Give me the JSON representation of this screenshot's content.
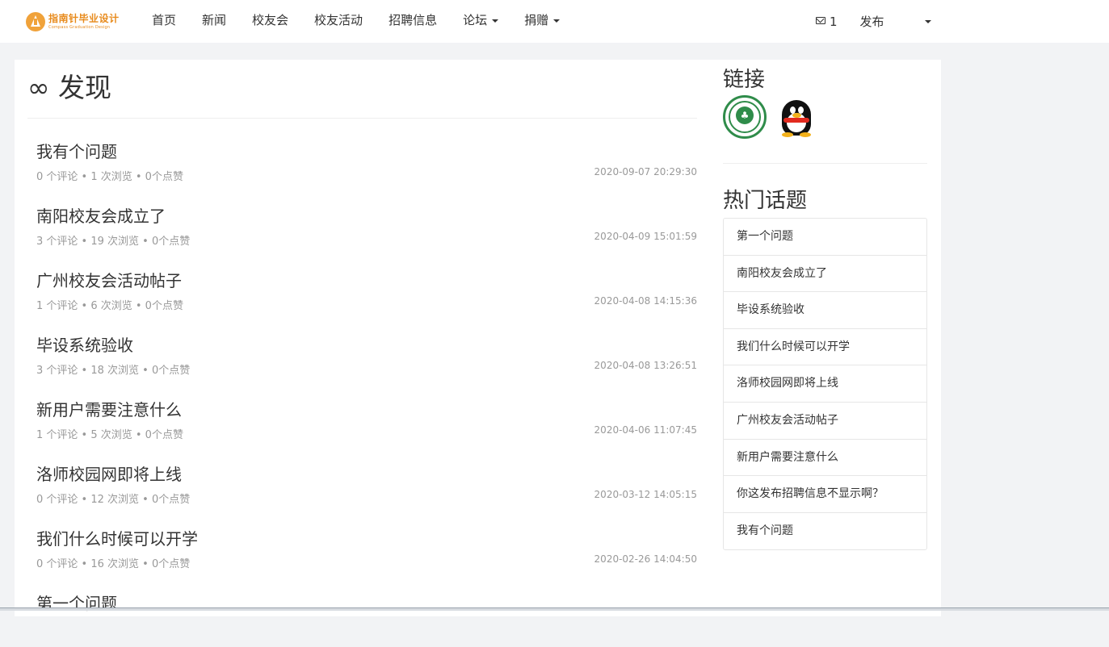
{
  "brand": {
    "name_cn": "指南针毕业设计",
    "name_en": "Compass Graduation Design",
    "color": "#e88b1d"
  },
  "nav": {
    "items": [
      {
        "label": "首页",
        "dropdown": false
      },
      {
        "label": "新闻",
        "dropdown": false
      },
      {
        "label": "校友会",
        "dropdown": false
      },
      {
        "label": "校友活动",
        "dropdown": false
      },
      {
        "label": "招聘信息",
        "dropdown": false
      },
      {
        "label": "论坛",
        "dropdown": true
      },
      {
        "label": "捐赠",
        "dropdown": true
      }
    ],
    "message_count": "1",
    "publish_label": "发布"
  },
  "main": {
    "title": "∞ 发现",
    "questions": [
      {
        "title": "我有个问题",
        "meta": "0 个评论 • 1 次浏览 • 0个点赞",
        "time": "2020-09-07 20:29:30"
      },
      {
        "title": "南阳校友会成立了",
        "meta": "3 个评论 • 19 次浏览 • 0个点赞",
        "time": "2020-04-09 15:01:59"
      },
      {
        "title": "广州校友会活动帖子",
        "meta": "1 个评论 • 6 次浏览 • 0个点赞",
        "time": "2020-04-08 14:15:36"
      },
      {
        "title": "毕设系统验收",
        "meta": "3 个评论 • 18 次浏览 • 0个点赞",
        "time": "2020-04-08 13:26:51"
      },
      {
        "title": "新用户需要注意什么",
        "meta": "1 个评论 • 5 次浏览 • 0个点赞",
        "time": "2020-04-06 11:07:45"
      },
      {
        "title": "洛师校园网即将上线",
        "meta": "0 个评论 • 12 次浏览 • 0个点赞",
        "time": "2020-03-12 14:05:15"
      },
      {
        "title": "我们什么时候可以开学",
        "meta": "0 个评论 • 16 次浏览 • 0个点赞",
        "time": "2020-02-26 14:04:50"
      },
      {
        "title": "第一个问题",
        "meta": "",
        "time": ""
      }
    ]
  },
  "sidebar": {
    "links_heading": "链接",
    "links": [
      {
        "icon": "school-logo-icon",
        "color": "#2f8c4a"
      },
      {
        "icon": "qq-penguin-icon",
        "color": "#111111"
      }
    ],
    "hot_heading": "热门话题",
    "hot_topics": [
      "第一个问题",
      "南阳校友会成立了",
      "毕设系统验收",
      "我们什么时候可以开学",
      "洛师校园网即将上线",
      "广州校友会活动帖子",
      "新用户需要注意什么",
      "你这发布招聘信息不显示啊？",
      "我有个问题"
    ]
  }
}
